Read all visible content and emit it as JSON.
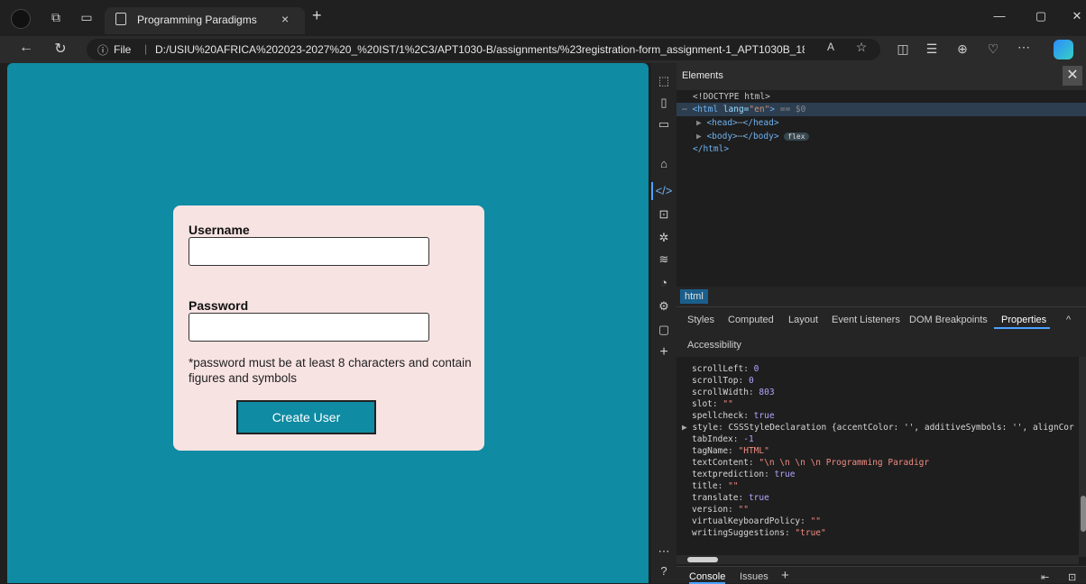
{
  "browser": {
    "tab_title": "Programming Paradigms",
    "tab_close": "×",
    "new_tab": "+",
    "url_prefix": "File",
    "url_separator": "|",
    "url": "D:/USIU%20AFRICA%202023-2027%20_%20IST/1%2C3/APT1030-B/assignments/%23registration-form_assignment-1_APT1030B_18...",
    "window_controls": [
      "—",
      "▢",
      "✕"
    ]
  },
  "form": {
    "username_label": "Username",
    "username_value": "",
    "password_label": "Password",
    "password_value": "",
    "hint": "*password must be at least 8 characters and contain figures and symbols",
    "submit_label": "Create User"
  },
  "colors": {
    "page_background": "#0f8ba3",
    "card_background": "#f8e3e3",
    "button_background": "#0f8ba3"
  },
  "devtools": {
    "panel_title": "Elements",
    "close": "✕",
    "dom": {
      "doctype": "<!DOCTYPE html>",
      "html_open_tag": "<html",
      "html_attr": "lang=",
      "html_attr_val": "\"en\"",
      "html_close_bracket": ">",
      "html_ref": "== $0",
      "head": "<head>",
      "head_ellipsis": "⋯",
      "head_close": "</head>",
      "body": "<body>",
      "body_ellipsis": "⋯",
      "body_close": "</body>",
      "body_badge": "flex",
      "html_close": "</html>"
    },
    "breadcrumb": "html",
    "subtabs": [
      "Styles",
      "Computed",
      "Layout",
      "Event Listeners",
      "DOM Breakpoints",
      "Properties"
    ],
    "active_subtab": "Properties",
    "subtab_accessibility": "Accessibility",
    "properties": [
      {
        "key": "scrollLeft",
        "value": "0",
        "type": "number"
      },
      {
        "key": "scrollTop",
        "value": "0",
        "type": "number"
      },
      {
        "key": "scrollWidth",
        "value": "803",
        "type": "number"
      },
      {
        "key": "slot",
        "value": "\"\"",
        "type": "string"
      },
      {
        "key": "spellcheck",
        "value": "true",
        "type": "bool"
      },
      {
        "key": "style",
        "value": "CSSStyleDeclaration {accentColor: '', additiveSymbols: '', alignCor",
        "type": "object"
      },
      {
        "key": "tabIndex",
        "value": "-1",
        "type": "number"
      },
      {
        "key": "tagName",
        "value": "\"HTML\"",
        "type": "string"
      },
      {
        "key": "textContent",
        "value": "\"\\n        \\n        \\n        \\n        Programming Paradigr",
        "type": "string"
      },
      {
        "key": "textprediction",
        "value": "true",
        "type": "bool"
      },
      {
        "key": "title",
        "value": "\"\"",
        "type": "string"
      },
      {
        "key": "translate",
        "value": "true",
        "type": "bool"
      },
      {
        "key": "version",
        "value": "\"\"",
        "type": "string"
      },
      {
        "key": "virtualKeyboardPolicy",
        "value": "\"\"",
        "type": "string"
      },
      {
        "key": "writingSuggestions",
        "value": "\"true\"",
        "type": "string"
      }
    ],
    "drawer_tabs": [
      "Console",
      "Issues"
    ],
    "drawer_add": "+"
  }
}
